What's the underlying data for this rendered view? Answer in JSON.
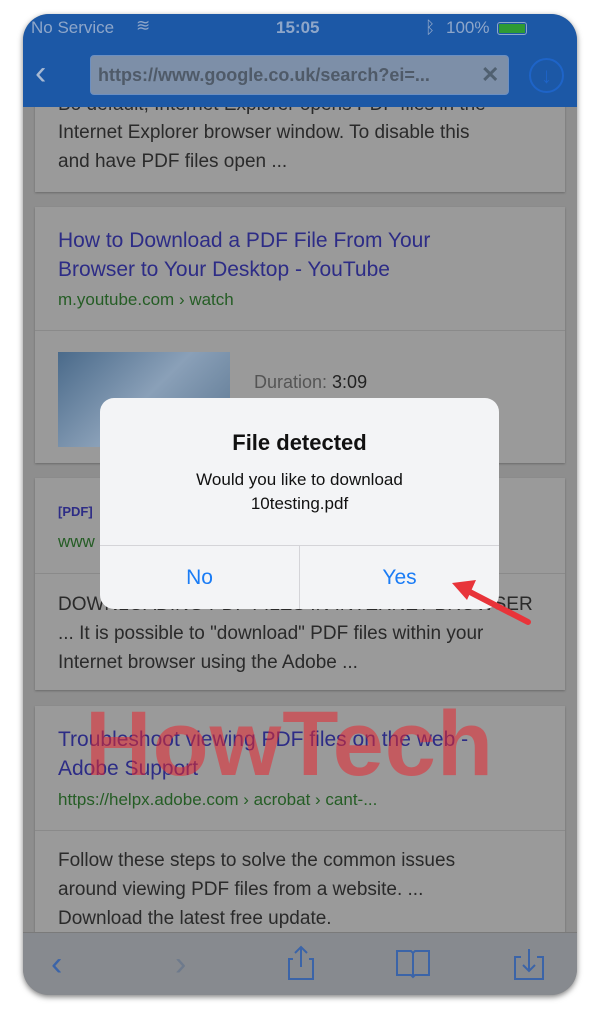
{
  "status": {
    "carrier": "No Service",
    "time": "15:05",
    "battery": "100%"
  },
  "header": {
    "url": "https://www.google.co.uk/search?ei=..."
  },
  "results": [
    {
      "lines": [
        "Bo default, Internet Explorer opens PDF files in the",
        "Internet Explorer browser window. To disable this",
        "and have PDF files open ..."
      ]
    },
    {
      "title": [
        "How to Download a PDF File From Your",
        "Browser to Your Desktop - YouTube"
      ],
      "url": "m.youtube.com › watch",
      "duration_label": "Duration: ",
      "duration": "3:09"
    },
    {
      "tag": "[PDF]",
      "url": "www",
      "lines": [
        "DOWNLOADING PDF FILES IN INTERNET BROWSER",
        "... It is possible to \"download\" PDF files within your",
        "Internet browser using the Adobe ..."
      ]
    },
    {
      "title": [
        "Troubleshoot viewing PDF files on the web -",
        "Adobe Support"
      ],
      "url": "https://helpx.adobe.com › acrobat › cant-...",
      "lines": [
        "Follow these steps to solve the common issues",
        "around viewing PDF files from a website. ...",
        "Download the latest free update."
      ]
    }
  ],
  "dialog": {
    "title": "File detected",
    "message_line1": "Would you like to download",
    "message_line2": "10testing.pdf",
    "no": "No",
    "yes": "Yes"
  },
  "watermark": "HowTech",
  "colors": {
    "header": "#1c58a6",
    "dialog_button": "#1a7cf5",
    "arrow": "#e8343a"
  }
}
